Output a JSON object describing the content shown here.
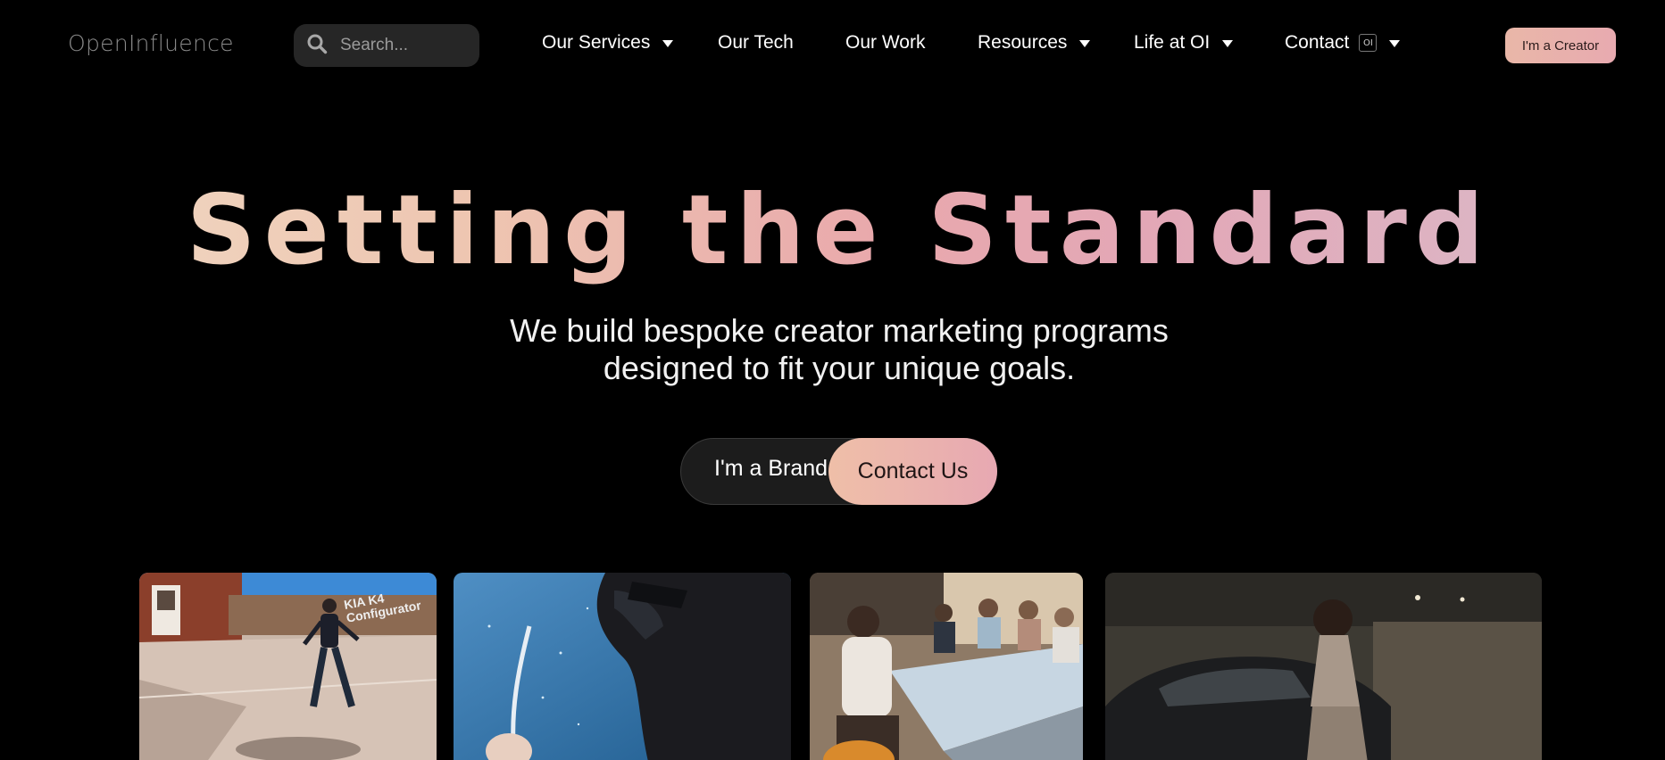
{
  "header": {
    "logo_text": "OpenInfluence",
    "search": {
      "placeholder": "Search..."
    },
    "nav": [
      {
        "label": "Our Services",
        "has_dropdown": true
      },
      {
        "label": "Our Tech",
        "has_dropdown": false
      },
      {
        "label": "Our Work",
        "has_dropdown": false
      },
      {
        "label": "Resources",
        "has_dropdown": true
      },
      {
        "label": "Life at OI",
        "has_dropdown": true
      },
      {
        "label": "Contact",
        "has_dropdown": true,
        "badge": "OI"
      }
    ],
    "creator_button": "I'm a Creator"
  },
  "hero": {
    "title": "Setting the Standard",
    "subtitle_line1": "We build bespoke creator marketing programs",
    "subtitle_line2": "designed to fit your unique goals.",
    "brand_button": "I'm a Brand",
    "contact_button": "Contact Us"
  },
  "gallery": {
    "cards": [
      {
        "scene": "street-kia-k4",
        "caption": "KIA K4 Configurator"
      },
      {
        "scene": "underwater-portrait"
      },
      {
        "scene": "dinner-table-group"
      },
      {
        "scene": "car-garage-woman"
      }
    ]
  },
  "colors": {
    "background": "#000000",
    "accent_peach": "#efbfa8",
    "accent_pink": "#e7a8b2",
    "search_bg": "#262626"
  }
}
